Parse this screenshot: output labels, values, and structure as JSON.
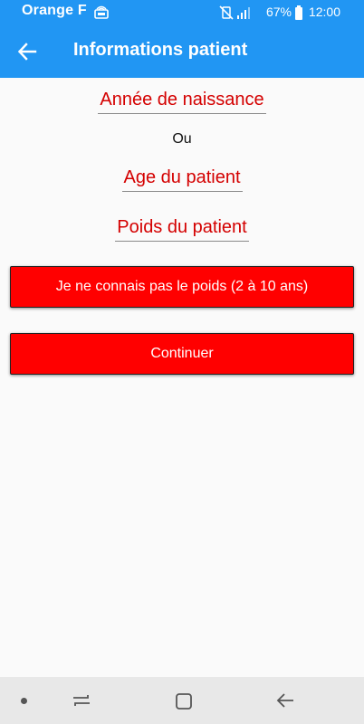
{
  "status_bar": {
    "carrier": "Orange F",
    "battery": "67%",
    "time": "12:00"
  },
  "app_bar": {
    "title": "Informations patient",
    "color": "#2196f3"
  },
  "form": {
    "birth_year_placeholder": "Année de naissance",
    "or_label": "Ou",
    "age_placeholder": "Age du patient",
    "weight_placeholder": "Poids du patient",
    "unknown_weight_button": "Je ne connais pas le poids (2 à 10 ans)",
    "continue_button": "Continuer",
    "accent_color": "#ff0000",
    "placeholder_color": "#d40000"
  },
  "icons": {
    "back": "arrow-left-icon",
    "mute": "vibrate-mute-icon",
    "signal": "signal-icon",
    "battery": "battery-icon",
    "carrier_extra": "sim-icon",
    "nav_recents": "recents-icon",
    "nav_home": "home-icon",
    "nav_back": "nav-back-icon"
  }
}
